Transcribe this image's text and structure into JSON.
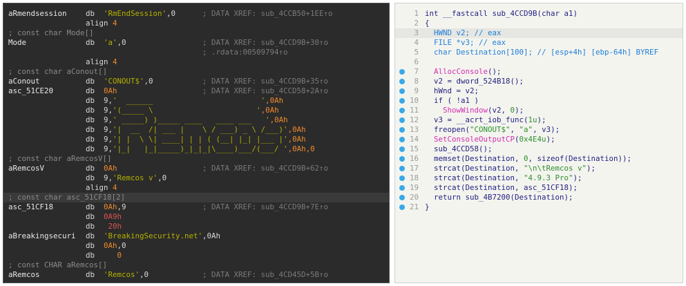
{
  "disassembly": {
    "lines": [
      {
        "label": "aRmendsession",
        "op": "db",
        "args": [
          {
            "t": "'RmEndSession'",
            "c": "str"
          },
          {
            "t": ",0",
            "c": "plain"
          }
        ],
        "comment": "; DATA XREF: sub_4CCB50+1EE↑o"
      },
      {
        "label": "",
        "op": "",
        "args": [
          {
            "t": "align ",
            "c": "plain"
          },
          {
            "t": "4",
            "c": "orange"
          }
        ],
        "comment": ""
      },
      {
        "type": "comment",
        "text": "; const char Mode[]"
      },
      {
        "label": "Mode",
        "op": "db",
        "args": [
          {
            "t": "'a'",
            "c": "str"
          },
          {
            "t": ",0",
            "c": "plain"
          }
        ],
        "comment": "; DATA XREF: sub_4CCD9B+30↑o"
      },
      {
        "label": "",
        "op": "",
        "args": [],
        "comment": "; .rdata:00509794↑o"
      },
      {
        "label": "",
        "op": "",
        "args": [
          {
            "t": "align ",
            "c": "plain"
          },
          {
            "t": "4",
            "c": "orange"
          }
        ],
        "comment": ""
      },
      {
        "type": "comment",
        "text": "; const char aConout[]"
      },
      {
        "label": "aConout",
        "op": "db",
        "args": [
          {
            "t": "'CONOUT$'",
            "c": "str"
          },
          {
            "t": ",0",
            "c": "plain"
          }
        ],
        "comment": "; DATA XREF: sub_4CCD9B+35↑o"
      },
      {
        "label": "asc_51CE20",
        "op": "db",
        "args": [
          {
            "t": "0Ah",
            "c": "orange"
          }
        ],
        "comment": "; DATA XREF: sub_4CCD58+2A↑o"
      },
      {
        "label": "",
        "op": "db",
        "args": [
          {
            "t": "9,",
            "c": "plain"
          },
          {
            "t": "'  ______                        '",
            "c": "str"
          },
          {
            "t": ",0Ah",
            "c": "orange"
          }
        ],
        "comment": ""
      },
      {
        "label": "",
        "op": "db",
        "args": [
          {
            "t": "9,",
            "c": "plain"
          },
          {
            "t": "'(_____ \\                       '",
            "c": "str"
          },
          {
            "t": ",0Ah",
            "c": "orange"
          }
        ],
        "comment": ""
      },
      {
        "label": "",
        "op": "db",
        "args": [
          {
            "t": "9,",
            "c": "plain"
          },
          {
            "t": "' _____) )_____ ____   ____ ___   '",
            "c": "str"
          },
          {
            "t": ",0Ah",
            "c": "orange"
          }
        ],
        "comment": ""
      },
      {
        "label": "",
        "op": "db",
        "args": [
          {
            "t": "9,",
            "c": "plain"
          },
          {
            "t": "'|  __  /| ___ |    \\ / ___) _ \\ /___)'",
            "c": "str"
          },
          {
            "t": ",0Ah",
            "c": "orange"
          }
        ],
        "comment": ""
      },
      {
        "label": "",
        "op": "db",
        "args": [
          {
            "t": "9,",
            "c": "plain"
          },
          {
            "t": "'| |  \\ \\| ____| | | ( (__| |_| |___ |'",
            "c": "str"
          },
          {
            "t": ",0Ah",
            "c": "orange"
          }
        ],
        "comment": ""
      },
      {
        "label": "",
        "op": "db",
        "args": [
          {
            "t": "9,",
            "c": "plain"
          },
          {
            "t": "'|_|   |_|_____)_|_|_|\\____)___/(___/ '",
            "c": "str"
          },
          {
            "t": ",0Ah,0",
            "c": "orange"
          }
        ],
        "comment": ""
      },
      {
        "type": "comment",
        "text": "; const char aRemcosV[]"
      },
      {
        "label": "aRemcosV",
        "op": "db",
        "args": [
          {
            "t": "0Ah",
            "c": "orange"
          }
        ],
        "comment": "; DATA XREF: sub_4CCD9B+62↑o"
      },
      {
        "label": "",
        "op": "db",
        "args": [
          {
            "t": "9,",
            "c": "plain"
          },
          {
            "t": "'Remcos v'",
            "c": "str"
          },
          {
            "t": ",0",
            "c": "plain"
          }
        ],
        "comment": ""
      },
      {
        "label": "",
        "op": "",
        "args": [
          {
            "t": "align ",
            "c": "plain"
          },
          {
            "t": "4",
            "c": "orange"
          }
        ],
        "comment": ""
      },
      {
        "type": "comment",
        "text": "; const char asc_51CF18[2]",
        "hl": true
      },
      {
        "label": "asc_51CF18",
        "op": "db",
        "args": [
          {
            "t": "0Ah",
            "c": "orange"
          },
          {
            "t": ",9",
            "c": "plain"
          }
        ],
        "comment": "; DATA XREF: sub_4CCD9B+7E↑o"
      },
      {
        "label": "",
        "op": "db",
        "args": [
          {
            "t": "0A9h",
            "c": "red"
          }
        ],
        "comment": ""
      },
      {
        "label": "",
        "op": "db",
        "args": [
          {
            "t": " 20h",
            "c": "red"
          }
        ],
        "comment": ""
      },
      {
        "label": "aBreakingsecuri",
        "op": "db",
        "args": [
          {
            "t": "'BreakingSecurity.net'",
            "c": "str"
          },
          {
            "t": ",0Ah",
            "c": "plain"
          }
        ],
        "comment": ""
      },
      {
        "label": "",
        "op": "db",
        "args": [
          {
            "t": "0Ah",
            "c": "orange"
          },
          {
            "t": ",0",
            "c": "plain"
          }
        ],
        "comment": ""
      },
      {
        "label": "",
        "op": "db",
        "args": [
          {
            "t": "   0",
            "c": "orange"
          }
        ],
        "comment": ""
      },
      {
        "type": "comment",
        "text": "; const CHAR aRemcos[]"
      },
      {
        "label": "aRemcos",
        "op": "db",
        "args": [
          {
            "t": "'Remcos'",
            "c": "str"
          },
          {
            "t": ",0",
            "c": "plain"
          }
        ],
        "comment": "; DATA XREF: sub_4CD45D+5B↑o"
      }
    ]
  },
  "pseudocode": {
    "lines": [
      {
        "n": "1",
        "dot": false,
        "hl": false,
        "parts": [
          {
            "t": "int __fastcall sub_4CCD9B(char a1)",
            "c": "kw"
          }
        ]
      },
      {
        "n": "2",
        "dot": false,
        "hl": false,
        "parts": [
          {
            "t": "{",
            "c": "kw"
          }
        ]
      },
      {
        "n": "3",
        "dot": false,
        "hl": true,
        "parts": [
          {
            "t": "  HWND v2; // eax",
            "c": "cmt"
          }
        ]
      },
      {
        "n": "4",
        "dot": false,
        "hl": false,
        "parts": [
          {
            "t": "  FILE *v3; // eax",
            "c": "cmt"
          }
        ]
      },
      {
        "n": "5",
        "dot": false,
        "hl": false,
        "parts": [
          {
            "t": "  char Destination[100]; // [esp+4h] [ebp-64h] BYREF",
            "c": "cmt"
          }
        ]
      },
      {
        "n": "6",
        "dot": false,
        "hl": false,
        "parts": [
          {
            "t": "",
            "c": "kw"
          }
        ]
      },
      {
        "n": "7",
        "dot": true,
        "hl": false,
        "parts": [
          {
            "t": "  ",
            "c": "kw"
          },
          {
            "t": "AllocConsole",
            "c": "fn"
          },
          {
            "t": "();",
            "c": "kw"
          }
        ]
      },
      {
        "n": "8",
        "dot": true,
        "hl": false,
        "parts": [
          {
            "t": "  v2 = dword_524B18();",
            "c": "kw"
          }
        ]
      },
      {
        "n": "9",
        "dot": true,
        "hl": false,
        "parts": [
          {
            "t": "  hWnd = v2;",
            "c": "kw"
          }
        ]
      },
      {
        "n": "10",
        "dot": true,
        "hl": false,
        "parts": [
          {
            "t": "  if ( !a1 )",
            "c": "kw"
          }
        ]
      },
      {
        "n": "11",
        "dot": true,
        "hl": false,
        "parts": [
          {
            "t": "    ",
            "c": "kw"
          },
          {
            "t": "ShowWindow",
            "c": "fn"
          },
          {
            "t": "(v2, ",
            "c": "kw"
          },
          {
            "t": "0",
            "c": "cnum"
          },
          {
            "t": ");",
            "c": "kw"
          }
        ]
      },
      {
        "n": "12",
        "dot": true,
        "hl": false,
        "parts": [
          {
            "t": "  v3 = __acrt_iob_func(",
            "c": "kw"
          },
          {
            "t": "1u",
            "c": "cnum"
          },
          {
            "t": ");",
            "c": "kw"
          }
        ]
      },
      {
        "n": "13",
        "dot": true,
        "hl": false,
        "parts": [
          {
            "t": "  freopen(",
            "c": "kw"
          },
          {
            "t": "\"CONOUT$\"",
            "c": "cstr"
          },
          {
            "t": ", ",
            "c": "kw"
          },
          {
            "t": "\"a\"",
            "c": "cstr"
          },
          {
            "t": ", v3);",
            "c": "kw"
          }
        ]
      },
      {
        "n": "14",
        "dot": true,
        "hl": false,
        "parts": [
          {
            "t": "  ",
            "c": "kw"
          },
          {
            "t": "SetConsoleOutputCP",
            "c": "fn"
          },
          {
            "t": "(",
            "c": "kw"
          },
          {
            "t": "0x4E4u",
            "c": "cnum"
          },
          {
            "t": ");",
            "c": "kw"
          }
        ]
      },
      {
        "n": "15",
        "dot": true,
        "hl": false,
        "parts": [
          {
            "t": "  sub_4CCD58();",
            "c": "kw"
          }
        ]
      },
      {
        "n": "16",
        "dot": true,
        "hl": false,
        "parts": [
          {
            "t": "  memset(Destination, ",
            "c": "kw"
          },
          {
            "t": "0",
            "c": "cnum"
          },
          {
            "t": ", sizeof(Destination));",
            "c": "kw"
          }
        ]
      },
      {
        "n": "17",
        "dot": true,
        "hl": false,
        "parts": [
          {
            "t": "  strcat(Destination, ",
            "c": "kw"
          },
          {
            "t": "\"\\n\\tRemcos v\"",
            "c": "cstr"
          },
          {
            "t": ");",
            "c": "kw"
          }
        ]
      },
      {
        "n": "18",
        "dot": true,
        "hl": false,
        "parts": [
          {
            "t": "  strcat(Destination, ",
            "c": "kw"
          },
          {
            "t": "\"4.9.3 Pro\"",
            "c": "cstr"
          },
          {
            "t": ");",
            "c": "kw"
          }
        ]
      },
      {
        "n": "19",
        "dot": true,
        "hl": false,
        "parts": [
          {
            "t": "  strcat(Destination, asc_51CF18);",
            "c": "kw"
          }
        ]
      },
      {
        "n": "20",
        "dot": true,
        "hl": false,
        "parts": [
          {
            "t": "  return sub_4B7200(Destination);",
            "c": "kw"
          }
        ]
      },
      {
        "n": "21",
        "dot": true,
        "hl": false,
        "parts": [
          {
            "t": "}",
            "c": "kw"
          }
        ]
      }
    ]
  },
  "colors": {
    "dark_bg": "#2b2b2b",
    "light_bg": "#f4f4ef",
    "string": "#b5b000",
    "number": "#f08a2c",
    "function": "#d12fb0",
    "breakpoint": "#38a8e8"
  }
}
